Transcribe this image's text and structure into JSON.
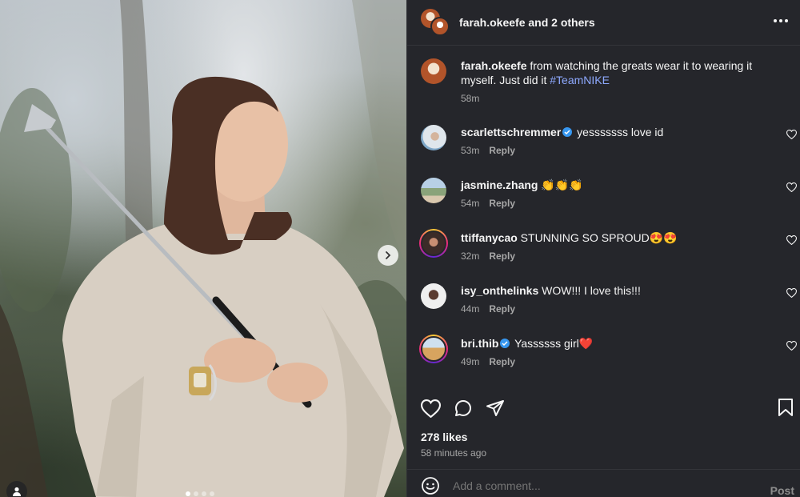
{
  "post": {
    "header": {
      "title_user": "farah.okeefe",
      "title_rest": " and 2 others"
    },
    "caption": {
      "username": "farah.okeefe",
      "text": " from watching the greats wear it to wearing it myself. Just did it ",
      "hashtag": "#TeamNIKE",
      "time": "58m"
    },
    "comments": [
      {
        "username": "scarlettschremmer",
        "verified": true,
        "text": " yesssssss love id",
        "time": "53m",
        "reply": "Reply",
        "avatar": "scarlett"
      },
      {
        "username": "jasmine.zhang",
        "verified": false,
        "text": " 👏👏👏",
        "time": "54m",
        "reply": "Reply",
        "avatar": "jasmine"
      },
      {
        "username": "ttiffanycao",
        "verified": false,
        "text": " STUNNING SO SPROUD😍😍",
        "time": "32m",
        "reply": "Reply",
        "avatar": "tiffany"
      },
      {
        "username": "isy_onthelinks",
        "verified": false,
        "text": " WOW!!! I love this!!!",
        "time": "44m",
        "reply": "Reply",
        "avatar": "isy"
      },
      {
        "username": "bri.thib",
        "verified": true,
        "text": " Yassssss girl❤️",
        "time": "49m",
        "reply": "Reply",
        "avatar": "bri"
      }
    ],
    "likes": "278 likes",
    "posted_ago": "58 minutes ago",
    "add_comment_placeholder": "Add a comment...",
    "post_label": "Post",
    "carousel": {
      "count": 4,
      "active": 0
    }
  },
  "colors": {
    "panel_bg": "#25262b",
    "hashtag": "#8ea9ff",
    "verified": "#3797f0",
    "muted_text": "#a8a8a8"
  }
}
